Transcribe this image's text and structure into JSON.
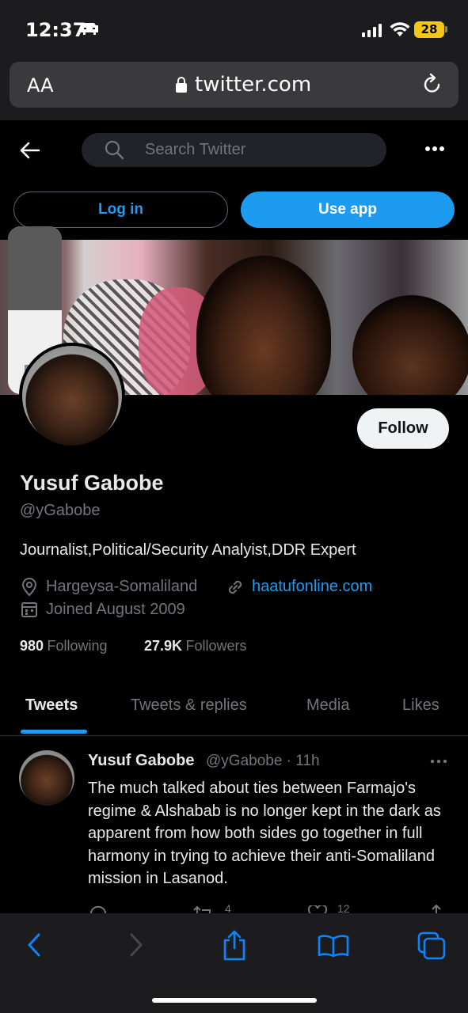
{
  "status_bar": {
    "time": "12:37",
    "battery": "28"
  },
  "safari": {
    "text_size_label": "AA",
    "url": "twitter.com"
  },
  "twitter": {
    "search": {
      "placeholder": "Search Twitter"
    },
    "login_label": "Log in",
    "use_app_label": "Use app"
  },
  "profile": {
    "follow_label": "Follow",
    "name": "Yusuf Gabobe",
    "handle": "@yGabobe",
    "bio": "Journalist,Political/Security Analyist,DDR Expert",
    "location": "Hargeysa-Somaliland",
    "website": "haatufonline.com",
    "joined": "Joined August 2009",
    "following_count": "980",
    "following_label": "Following",
    "followers_count": "27.9K",
    "followers_label": "Followers"
  },
  "tabs": [
    {
      "label": "Tweets",
      "active": true
    },
    {
      "label": "Tweets & replies",
      "active": false
    },
    {
      "label": "Media",
      "active": false
    },
    {
      "label": "Likes",
      "active": false
    }
  ],
  "volume_level": 0.5,
  "tweet": {
    "author_name": "Yusuf Gabobe",
    "author_meta": "@yGabobe · 11h",
    "text": "The much talked about ties between Farmajo's regime & Alshabab  is no longer kept in the dark as apparent from how both sides go together in full  harmony in trying to achieve their anti-Somaliland mission in Lasanod.",
    "retweets": "4",
    "likes": "12"
  },
  "colors": {
    "accent": "#1d9bf0",
    "background": "#000000",
    "muted": "#71767b"
  }
}
